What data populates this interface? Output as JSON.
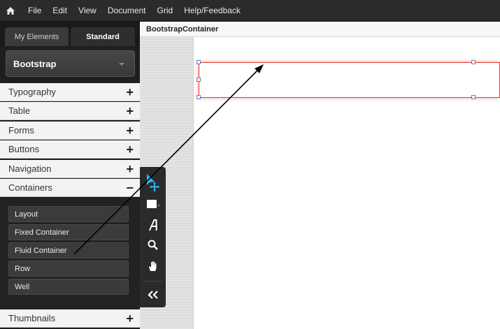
{
  "menu": {
    "items": [
      "File",
      "Edit",
      "View",
      "Document",
      "Grid",
      "Help/Feedback"
    ]
  },
  "sidebar": {
    "tabs": {
      "my_elements": "My Elements",
      "standard": "Standard"
    },
    "library": "Bootstrap",
    "categories": [
      {
        "label": "Typography",
        "toggle": "+"
      },
      {
        "label": "Table",
        "toggle": "+"
      },
      {
        "label": "Forms",
        "toggle": "+"
      },
      {
        "label": "Buttons",
        "toggle": "+"
      },
      {
        "label": "Navigation",
        "toggle": "+"
      },
      {
        "label": "Containers",
        "toggle": "−"
      }
    ],
    "container_items": [
      "Layout",
      "Fixed Container",
      "Fluid Container",
      "Row",
      "Well"
    ],
    "bottom_category": {
      "label": "Thumbnails",
      "toggle": "+"
    }
  },
  "page": {
    "title": "BootstrapContainer"
  },
  "colors": {
    "menubar": "#2b2b2b",
    "sidebar": "#1e1e1e",
    "selection": "#e53935",
    "handle": "#6b7bb5",
    "pointer_tool": "#29b6f6"
  },
  "tools": [
    "pointer-move-icon",
    "rectangle-icon",
    "text-icon",
    "zoom-icon",
    "hand-icon",
    "collapse-icon"
  ]
}
